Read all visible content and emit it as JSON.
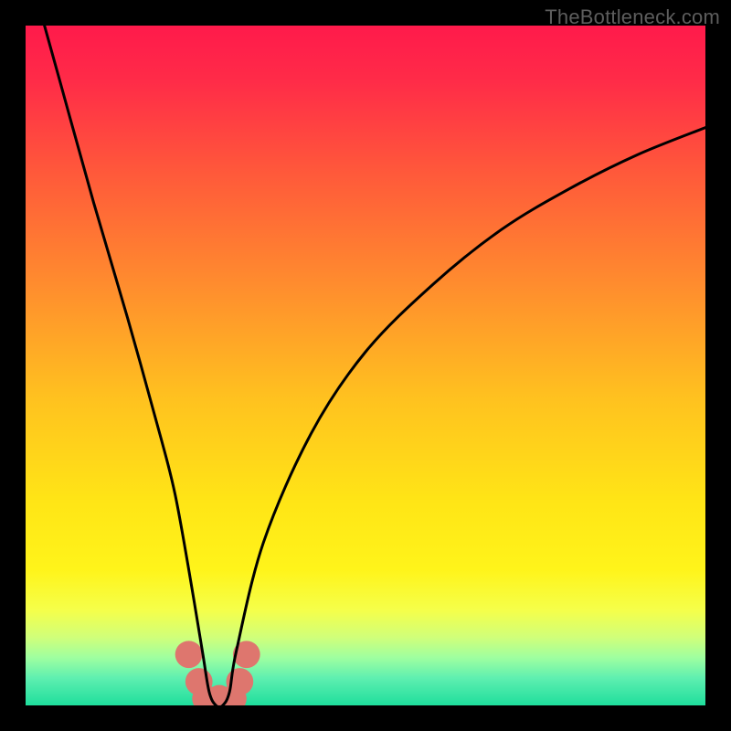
{
  "watermark": "TheBottleneck.com",
  "chart_data": {
    "type": "line",
    "title": "",
    "xlabel": "",
    "ylabel": "",
    "xlim": [
      0,
      100
    ],
    "ylim": [
      0,
      100
    ],
    "grid": false,
    "series": [
      {
        "name": "bottleneck-curve",
        "x": [
          0,
          5,
          10,
          15,
          20,
          22,
          24,
          26,
          27,
          28,
          29,
          30,
          31,
          35,
          42,
          50,
          60,
          70,
          80,
          90,
          100
        ],
        "values": [
          110,
          92,
          74,
          57,
          39,
          31,
          20,
          8,
          2,
          0,
          0,
          2,
          8,
          24,
          40,
          52,
          62,
          70,
          76,
          81,
          85
        ]
      }
    ],
    "markers": [
      {
        "name": "bump-1",
        "x": 24.0,
        "y": 7.5,
        "color": "#de766e",
        "r": 2.0
      },
      {
        "name": "bump-2",
        "x": 25.5,
        "y": 3.5,
        "color": "#de766e",
        "r": 2.0
      },
      {
        "name": "bump-3",
        "x": 26.5,
        "y": 1.0,
        "color": "#de766e",
        "r": 2.0
      },
      {
        "name": "bump-4",
        "x": 28.5,
        "y": 1.0,
        "color": "#de766e",
        "r": 2.0
      },
      {
        "name": "bump-5",
        "x": 30.5,
        "y": 1.0,
        "color": "#de766e",
        "r": 2.0
      },
      {
        "name": "bump-6",
        "x": 31.5,
        "y": 3.5,
        "color": "#de766e",
        "r": 2.0
      },
      {
        "name": "bump-7",
        "x": 32.5,
        "y": 7.5,
        "color": "#de766e",
        "r": 2.0
      }
    ],
    "gradient_stops": [
      {
        "offset": 0.0,
        "color": "#ff1a4b"
      },
      {
        "offset": 0.08,
        "color": "#ff2b48"
      },
      {
        "offset": 0.22,
        "color": "#ff5a3a"
      },
      {
        "offset": 0.38,
        "color": "#ff8c2e"
      },
      {
        "offset": 0.55,
        "color": "#ffc21f"
      },
      {
        "offset": 0.7,
        "color": "#ffe516"
      },
      {
        "offset": 0.8,
        "color": "#fff41a"
      },
      {
        "offset": 0.86,
        "color": "#f5ff4a"
      },
      {
        "offset": 0.9,
        "color": "#d0ff7a"
      },
      {
        "offset": 0.93,
        "color": "#9effa0"
      },
      {
        "offset": 0.96,
        "color": "#5eefb0"
      },
      {
        "offset": 1.0,
        "color": "#1fde9c"
      }
    ]
  }
}
